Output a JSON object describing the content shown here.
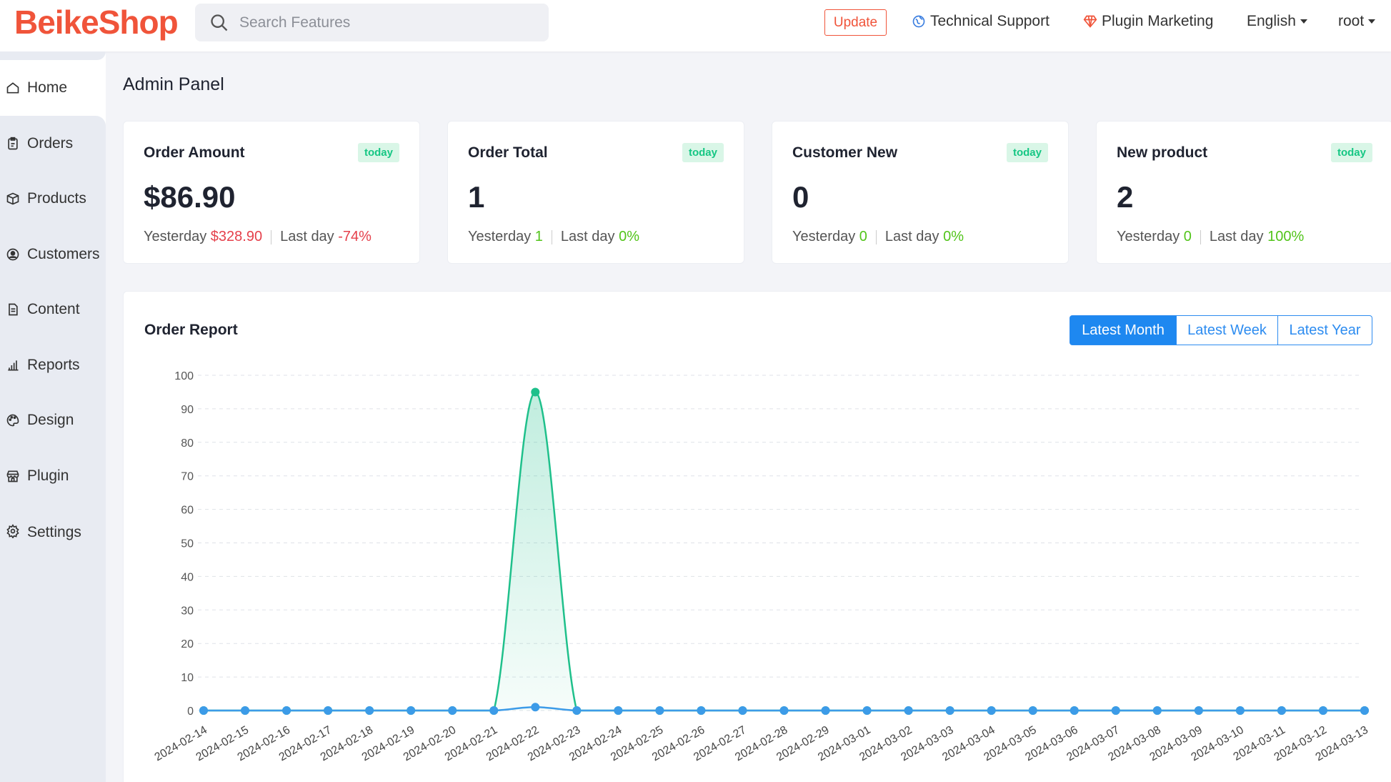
{
  "app": {
    "logo": "BeikeShop"
  },
  "search": {
    "placeholder": "Search Features"
  },
  "topbar": {
    "update_label": "Update",
    "support_label": "Technical Support",
    "plugin_marketing_label": "Plugin Marketing",
    "language_label": "English",
    "user_label": "root"
  },
  "sidebar": {
    "items": [
      {
        "label": "Home",
        "icon": "home-icon"
      },
      {
        "label": "Orders",
        "icon": "clipboard-icon"
      },
      {
        "label": "Products",
        "icon": "box-icon"
      },
      {
        "label": "Customers",
        "icon": "user-circle-icon"
      },
      {
        "label": "Content",
        "icon": "document-icon"
      },
      {
        "label": "Reports",
        "icon": "bar-chart-icon"
      },
      {
        "label": "Design",
        "icon": "palette-icon"
      },
      {
        "label": "Plugin",
        "icon": "store-icon"
      },
      {
        "label": "Settings",
        "icon": "gear-icon"
      }
    ]
  },
  "page": {
    "title": "Admin Panel"
  },
  "cards": [
    {
      "title": "Order Amount",
      "badge": "today",
      "value": "$86.90",
      "yesterday_label": "Yesterday",
      "yesterday_value": "$328.90",
      "lastday_label": "Last day",
      "lastday_value": "-74%"
    },
    {
      "title": "Order Total",
      "badge": "today",
      "value": "1",
      "yesterday_label": "Yesterday",
      "yesterday_value": "1",
      "lastday_label": "Last day",
      "lastday_value": "0%"
    },
    {
      "title": "Customer New",
      "badge": "today",
      "value": "0",
      "yesterday_label": "Yesterday",
      "yesterday_value": "0",
      "lastday_label": "Last day",
      "lastday_value": "0%"
    },
    {
      "title": "New product",
      "badge": "today",
      "value": "2",
      "yesterday_label": "Yesterday",
      "yesterday_value": "0",
      "lastday_label": "Last day",
      "lastday_value": "100%"
    }
  ],
  "report": {
    "title": "Order Report",
    "tabs": [
      "Latest Month",
      "Latest Week",
      "Latest Year"
    ],
    "active_tab": "Latest Month"
  },
  "colors": {
    "brand": "#f0543a",
    "accent": "#1e88f0",
    "series_amount": "#1fc08b",
    "series_total": "#3c9be8",
    "negative": "#e5404b",
    "positive": "#52c41a"
  },
  "chart_data": {
    "type": "area",
    "title": "",
    "xlabel": "",
    "ylabel": "",
    "ylim": [
      0,
      100
    ],
    "yticks": [
      0,
      10,
      20,
      30,
      40,
      50,
      60,
      70,
      80,
      90,
      100
    ],
    "grid": true,
    "x": [
      "2024-02-14",
      "2024-02-15",
      "2024-02-16",
      "2024-02-17",
      "2024-02-18",
      "2024-02-19",
      "2024-02-20",
      "2024-02-21",
      "2024-02-22",
      "2024-02-23",
      "2024-02-24",
      "2024-02-25",
      "2024-02-26",
      "2024-02-27",
      "2024-02-28",
      "2024-02-29",
      "2024-03-01",
      "2024-03-02",
      "2024-03-03",
      "2024-03-04",
      "2024-03-05",
      "2024-03-06",
      "2024-03-07",
      "2024-03-08",
      "2024-03-09",
      "2024-03-10",
      "2024-03-11",
      "2024-03-12",
      "2024-03-13"
    ],
    "series": [
      {
        "values": [
          0,
          0,
          0,
          0,
          0,
          0,
          0,
          0,
          95,
          0,
          0,
          0,
          0,
          0,
          0,
          0,
          0,
          0,
          0,
          0,
          0,
          0,
          0,
          0,
          0,
          0,
          0,
          0,
          0
        ],
        "color": "#1fc08b",
        "fill": true
      },
      {
        "values": [
          0,
          0,
          0,
          0,
          0,
          0,
          0,
          0,
          1,
          0,
          0,
          0,
          0,
          0,
          0,
          0,
          0,
          0,
          0,
          0,
          0,
          0,
          0,
          0,
          0,
          0,
          0,
          0,
          0
        ],
        "color": "#3c9be8",
        "fill": false
      }
    ]
  }
}
